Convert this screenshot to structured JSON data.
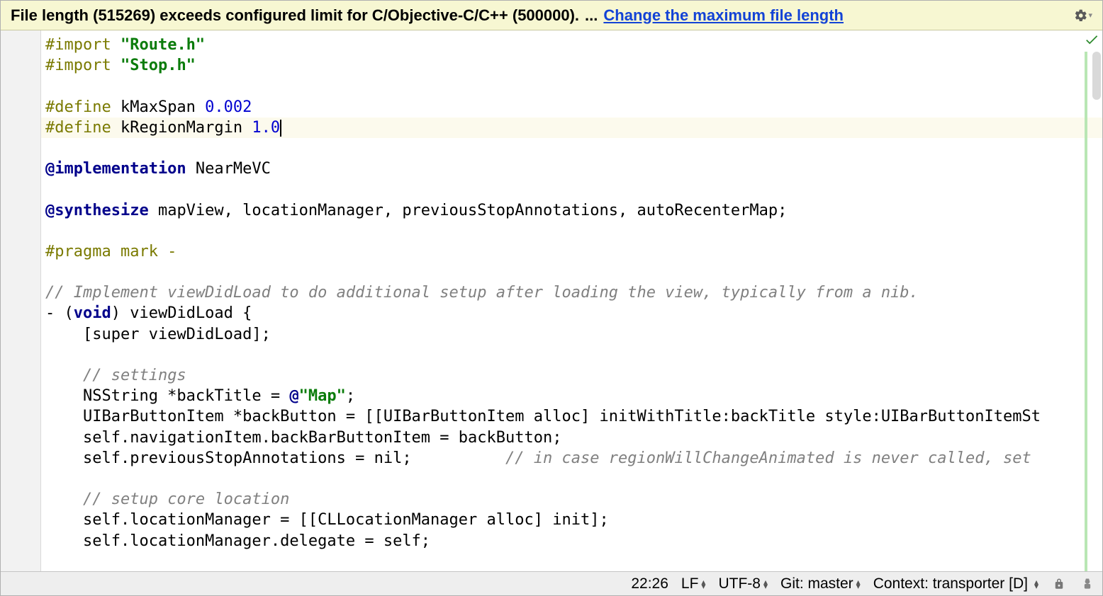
{
  "notification": {
    "message": "File length (515269) exceeds configured limit for C/Objective-C/C++ (500000).",
    "ellipsis": "...",
    "link": "Change the maximum file length"
  },
  "code": {
    "lines": [
      [
        {
          "t": "macro",
          "v": "#import "
        },
        {
          "t": "string",
          "v": "\"Route.h\""
        }
      ],
      [
        {
          "t": "macro",
          "v": "#import "
        },
        {
          "t": "string",
          "v": "\"Stop.h\""
        }
      ],
      [],
      [
        {
          "t": "macro",
          "v": "#define"
        },
        {
          "t": "plain",
          "v": " kMaxSpan "
        },
        {
          "t": "num",
          "v": "0.002"
        }
      ],
      [
        {
          "t": "macro",
          "v": "#define"
        },
        {
          "t": "plain",
          "v": " kRegionMargin "
        },
        {
          "t": "num",
          "v": "1.0"
        }
      ],
      [],
      [
        {
          "t": "kw",
          "v": "@implementation"
        },
        {
          "t": "plain",
          "v": " NearMeVC"
        }
      ],
      [],
      [
        {
          "t": "kw",
          "v": "@synthesize"
        },
        {
          "t": "plain",
          "v": " mapView, locationManager, previousStopAnnotations, autoRecenterMap;"
        }
      ],
      [],
      [
        {
          "t": "macro",
          "v": "#pragma mark -"
        }
      ],
      [],
      [
        {
          "t": "comment",
          "v": "// Implement viewDidLoad to do additional setup after loading the view, typically from a nib."
        }
      ],
      [
        {
          "t": "plain",
          "v": "- ("
        },
        {
          "t": "kw",
          "v": "void"
        },
        {
          "t": "plain",
          "v": ") viewDidLoad {"
        }
      ],
      [
        {
          "t": "plain",
          "v": "    [super viewDidLoad];"
        }
      ],
      [],
      [
        {
          "t": "plain",
          "v": "    "
        },
        {
          "t": "comment",
          "v": "// settings"
        }
      ],
      [
        {
          "t": "plain",
          "v": "    NSString *backTitle = "
        },
        {
          "t": "kw",
          "v": "@"
        },
        {
          "t": "string",
          "v": "\"Map\""
        },
        {
          "t": "plain",
          "v": ";"
        }
      ],
      [
        {
          "t": "plain",
          "v": "    UIBarButtonItem *backButton = [[UIBarButtonItem alloc] initWithTitle:backTitle style:UIBarButtonItemSt"
        }
      ],
      [
        {
          "t": "plain",
          "v": "    self.navigationItem.backBarButtonItem = backButton;"
        }
      ],
      [
        {
          "t": "plain",
          "v": "    self.previousStopAnnotations = nil;          "
        },
        {
          "t": "comment",
          "v": "// in case regionWillChangeAnimated is never called, set"
        }
      ],
      [],
      [
        {
          "t": "plain",
          "v": "    "
        },
        {
          "t": "comment",
          "v": "// setup core location"
        }
      ],
      [
        {
          "t": "plain",
          "v": "    self.locationManager = [[CLLocationManager alloc] init];"
        }
      ],
      [
        {
          "t": "plain",
          "v": "    self.locationManager.delegate = self;"
        }
      ]
    ],
    "highlight_index": 4
  },
  "status": {
    "cursor": "22:26",
    "line_sep": "LF",
    "encoding": "UTF-8",
    "git": "Git: master",
    "context": "Context: transporter [D]"
  }
}
